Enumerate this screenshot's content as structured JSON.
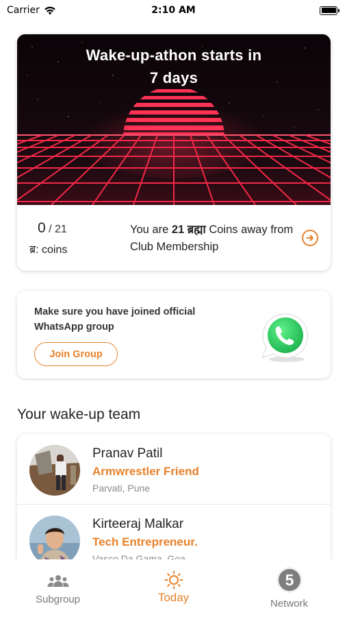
{
  "status_bar": {
    "carrier": "Carrier",
    "time": "2:10 AM"
  },
  "hero": {
    "title_line1": "Wake-up-athon starts in",
    "title_line2": "7 days",
    "coins_current": "0",
    "coins_total": "/ 21",
    "coins_label": "ब्र: coins",
    "away_prefix": "You are ",
    "away_count": "21 ब्रह्मा",
    "away_suffix": " Coins away from Club Membership"
  },
  "whatsapp": {
    "message": "Make sure you have joined official WhatsApp group",
    "button_label": "Join Group"
  },
  "team": {
    "heading": "Your wake-up team",
    "members": [
      {
        "name": "Pranav Patil",
        "role": "Armwrestler Friend",
        "location": "Parvati, Pune"
      },
      {
        "name": "Kirteeraj Malkar",
        "role": "Tech Entrepreneur.",
        "location": "Vasco Da Gama, Goa"
      }
    ]
  },
  "tab_bar": {
    "tabs": [
      {
        "label": "Subgroup",
        "icon": "group-icon"
      },
      {
        "label": "Today",
        "icon": "sun-icon",
        "active": true
      },
      {
        "label": "Network",
        "icon": "network-5-badge-icon",
        "badge": "5"
      }
    ]
  },
  "colors": {
    "accent": "#e8812a",
    "whatsapp": "#25d366",
    "neon": "#ff2a4a"
  }
}
